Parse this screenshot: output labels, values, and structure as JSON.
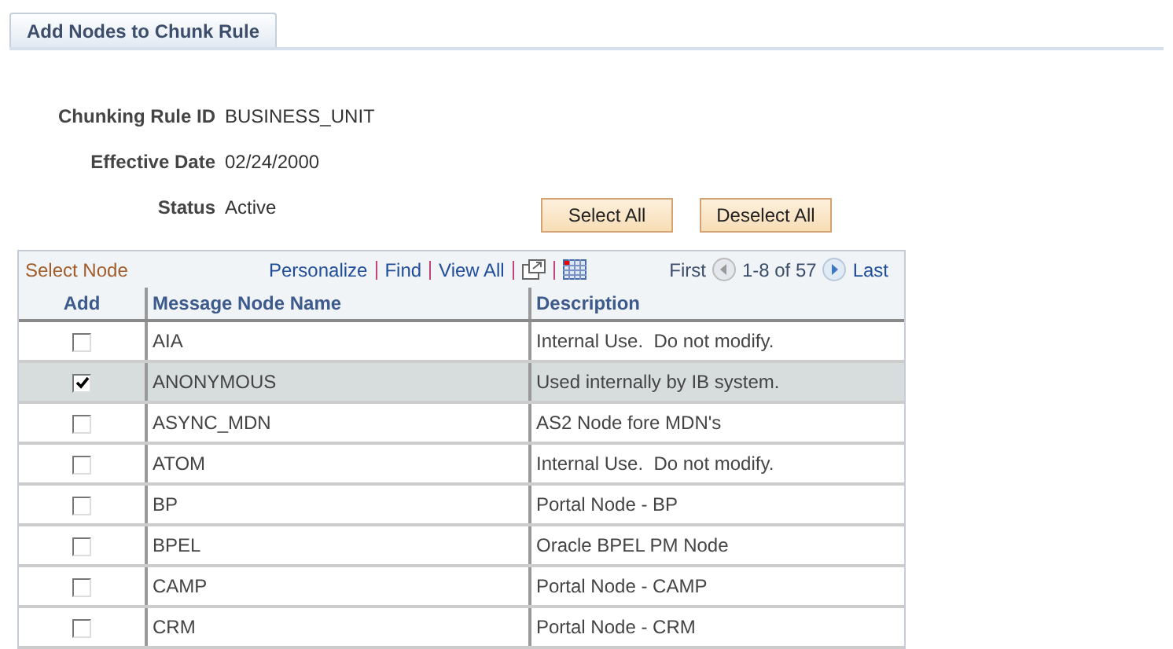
{
  "tab": {
    "label": "Add Nodes to Chunk Rule",
    "selected": true
  },
  "fields": [
    {
      "label": "Chunking Rule ID",
      "value": "BUSINESS_UNIT"
    },
    {
      "label": "Effective Date",
      "value": "02/24/2000"
    },
    {
      "label": "Status",
      "value": "Active"
    }
  ],
  "buttons": [
    "Select All",
    "Deselect All"
  ],
  "grid": {
    "title": "Select Node",
    "links": [
      "Personalize",
      "Find",
      "View All"
    ],
    "nav": {
      "first": "First",
      "range": "1-8 of 57",
      "last": "Last"
    },
    "columns": [
      "Add",
      "Message Node Name",
      "Description"
    ],
    "rows": [
      {
        "name": "AIA",
        "description": "Internal Use.  Do not modify.",
        "checked": false
      },
      {
        "name": "ANONYMOUS",
        "description": "Used internally by IB system.",
        "checked": true
      },
      {
        "name": "ASYNC_MDN",
        "description": "AS2 Node fore MDN's",
        "checked": false
      },
      {
        "name": "ATOM",
        "description": "Internal Use.  Do not modify.",
        "checked": false
      },
      {
        "name": "BP",
        "description": "Portal Node - BP",
        "checked": false
      },
      {
        "name": "BPEL",
        "description": "Oracle BPEL PM Node",
        "checked": false
      },
      {
        "name": "CAMP",
        "description": "Portal Node - CAMP",
        "checked": false
      },
      {
        "name": "CRM",
        "description": "Portal Node - CRM",
        "checked": false
      }
    ]
  }
}
